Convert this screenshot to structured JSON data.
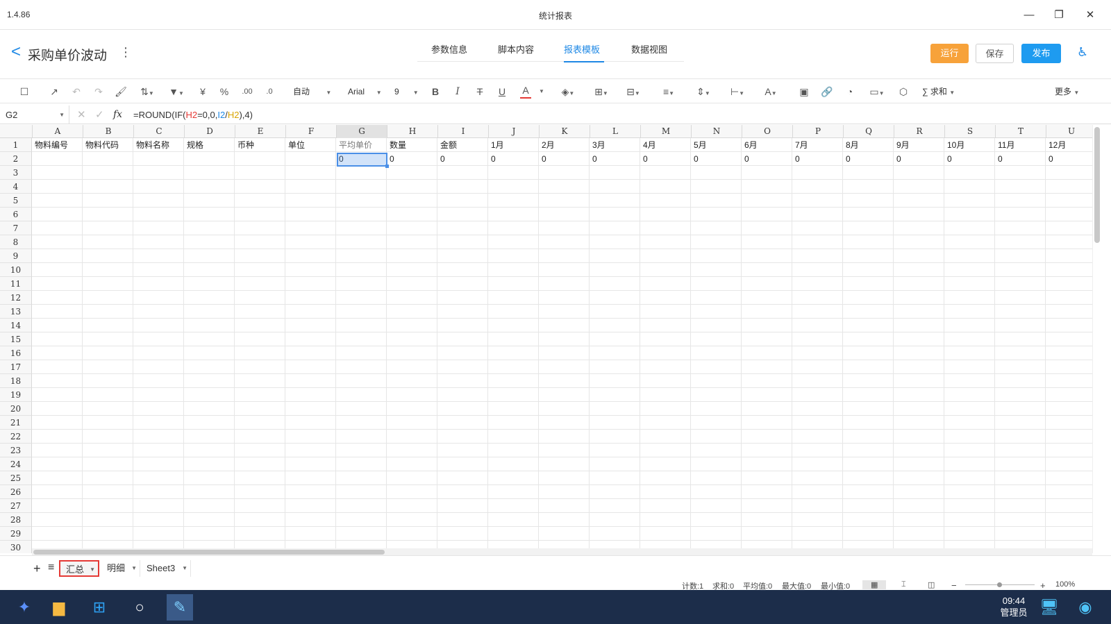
{
  "window": {
    "version": "1.4.86",
    "title": "统计报表"
  },
  "header": {
    "report_title": "采购单价波动",
    "tabs": [
      {
        "label": "参数信息"
      },
      {
        "label": "脚本内容"
      },
      {
        "label": "报表模板"
      },
      {
        "label": "数据视图"
      }
    ],
    "active_tab": "报表模板",
    "run_label": "运行",
    "save_label": "保存",
    "publish_label": "发布",
    "accent": "#1e88e5",
    "run_color": "#f7a23a",
    "publish_color": "#1e9bf0"
  },
  "toolbar": {
    "currency_symbol": "¥",
    "percent_symbol": "%",
    "format_select": "自动",
    "font_select": "Arial",
    "size_select": "9",
    "bold": "B",
    "italic": "I",
    "strike": "T",
    "underline": "U",
    "font_color_glyph": "A",
    "font_color": "#e53935",
    "text_rotate_glyph": "A",
    "sum_label": "求和",
    "more_label": "更多"
  },
  "formula_bar": {
    "cell_ref": "G2",
    "fx_label": "fx",
    "formula_parts": [
      "=ROUND(IF(",
      "H2",
      "=0,0,",
      "I2",
      "/",
      "H2",
      "),4)"
    ]
  },
  "grid": {
    "columns": [
      "A",
      "B",
      "C",
      "D",
      "E",
      "F",
      "G",
      "H",
      "I",
      "J",
      "K",
      "L",
      "M",
      "N",
      "O",
      "P",
      "Q",
      "R",
      "S",
      "T",
      "U"
    ],
    "selected_column": "G",
    "rows": [
      "1",
      "2",
      "3",
      "4",
      "5",
      "6",
      "7",
      "8",
      "9",
      "10",
      "11",
      "12",
      "13",
      "14",
      "15",
      "16",
      "17",
      "18",
      "19",
      "20",
      "21",
      "22",
      "23",
      "24",
      "25",
      "26",
      "27",
      "28",
      "29",
      "30"
    ],
    "row1": [
      "物料编号",
      "物料代码",
      "物料名称",
      "规格",
      "币种",
      "单位",
      "平均单价",
      "数量",
      "金额",
      "1月",
      "2月",
      "3月",
      "4月",
      "5月",
      "6月",
      "7月",
      "8月",
      "9月",
      "10月",
      "11月",
      "12月"
    ],
    "row2": [
      "",
      "",
      "",
      "",
      "",
      "",
      "0",
      "0",
      "0",
      "0",
      "0",
      "0",
      "0",
      "0",
      "0",
      "0",
      "0",
      "0",
      "0",
      "0",
      "0"
    ]
  },
  "sheets": {
    "tabs": [
      {
        "label": "汇总"
      },
      {
        "label": "明细"
      },
      {
        "label": "Sheet3"
      }
    ],
    "active": "汇总"
  },
  "status": {
    "count": "计数:1",
    "sum": "求和:0",
    "avg": "平均值:0",
    "max": "最大值:0",
    "min": "最小值:0",
    "zoom": "100%"
  },
  "taskbar": {
    "time": "09:44",
    "user": "管理员"
  }
}
